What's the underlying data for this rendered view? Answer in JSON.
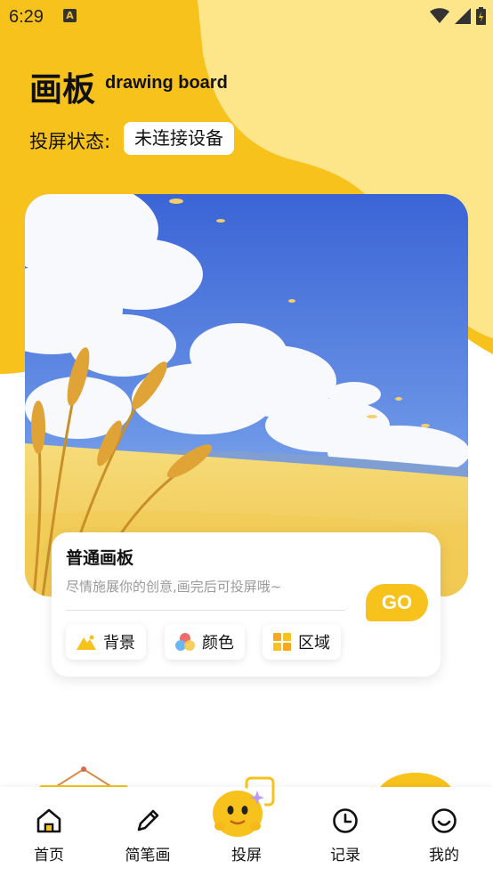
{
  "status_bar": {
    "time": "6:29",
    "icons": [
      "text-input-icon",
      "wifi-icon",
      "signal-icon",
      "battery-icon"
    ]
  },
  "header": {
    "title": "画板",
    "subtitle": "drawing board",
    "projection_label": "投屏状态:",
    "projection_status": "未连接设备"
  },
  "hero_card": {
    "image": "wheat-field-sky-illustration",
    "title": "普通画板",
    "description": "尽情施展你的创意,画完后可投屏哦~",
    "go_label": "GO",
    "options": [
      {
        "label": "背景",
        "icon": "mountain-icon"
      },
      {
        "label": "颜色",
        "icon": "color-circles-icon"
      },
      {
        "label": "区域",
        "icon": "grid-icon"
      }
    ]
  },
  "tab_bar": {
    "items": [
      {
        "label": "首页",
        "icon": "home-icon"
      },
      {
        "label": "简笔画",
        "icon": "pencil-icon"
      },
      {
        "label": "投屏",
        "icon": "smiley-mascot-icon"
      },
      {
        "label": "记录",
        "icon": "clock-icon"
      },
      {
        "label": "我的",
        "icon": "smile-icon"
      }
    ]
  },
  "colors": {
    "accent_yellow": "#F8C21C",
    "light_yellow": "#FDE58A",
    "background": "#FFFFFF"
  }
}
